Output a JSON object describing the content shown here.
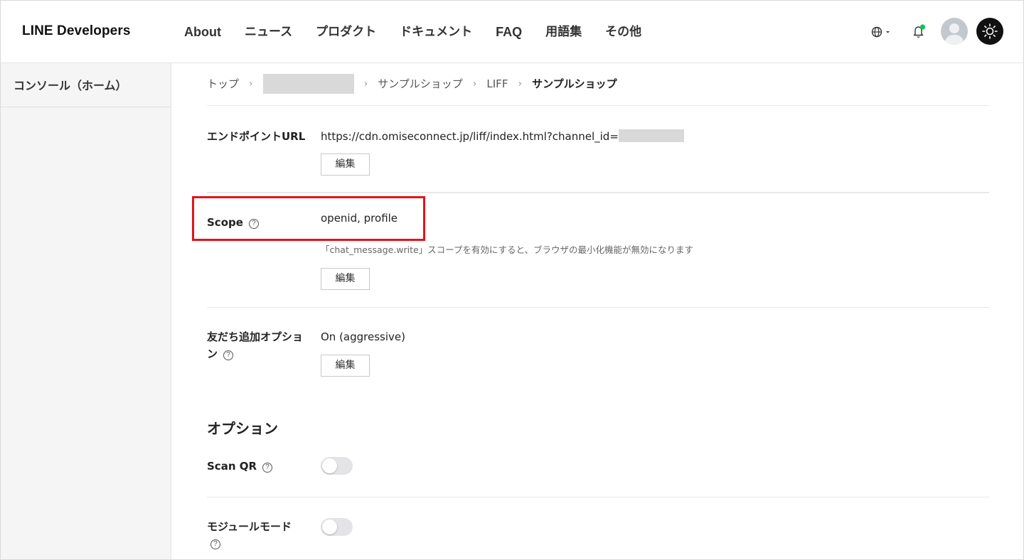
{
  "header": {
    "logo": "LINE Developers",
    "nav": [
      "About",
      "ニュース",
      "プロダクト",
      "ドキュメント",
      "FAQ",
      "用語集",
      "その他"
    ]
  },
  "sidebar": {
    "items": [
      {
        "label": "コンソール（ホーム）"
      }
    ]
  },
  "breadcrumb": {
    "items": [
      "トップ",
      "サンプルショップ",
      "LIFF",
      "サンプルショップ"
    ]
  },
  "endpoint": {
    "label": "エンドポイントURL",
    "value": "https://cdn.omiseconnect.jp/liff/index.html?channel_id=",
    "edit_label": "編集"
  },
  "scope": {
    "label": "Scope",
    "value": "openid, profile",
    "hint": "「chat_message.write」スコープを有効にすると、ブラウザの最小化機能が無効になります",
    "edit_label": "編集"
  },
  "friend_option": {
    "label_line1": "友だち追加オプショ",
    "label_line2": "ン",
    "value": "On (aggressive)",
    "edit_label": "編集"
  },
  "options": {
    "title": "オプション",
    "scan_qr": {
      "label": "Scan QR",
      "enabled": false
    },
    "module_mode": {
      "label": "モジュールモード",
      "enabled": false
    }
  },
  "help_glyph": "?",
  "colors": {
    "highlight": "#e3141b",
    "notification_dot": "#06c755",
    "toggle_off": "#e4e4e6"
  }
}
